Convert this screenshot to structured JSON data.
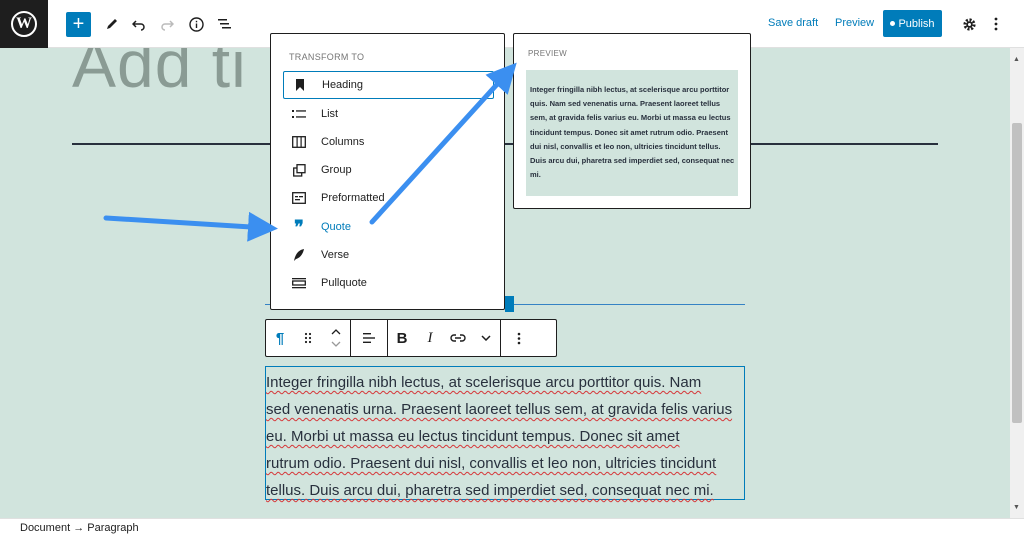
{
  "topbar": {
    "logo_letter": "W",
    "add_label": "+",
    "save_draft": "Save draft",
    "preview": "Preview",
    "publish": "Publish"
  },
  "canvas": {
    "title_text": "Add ti"
  },
  "transform_menu": {
    "header": "TRANSFORM TO",
    "items": [
      {
        "label": "Heading",
        "icon": "bookmark-icon"
      },
      {
        "label": "List",
        "icon": "list-icon"
      },
      {
        "label": "Columns",
        "icon": "columns-icon"
      },
      {
        "label": "Group",
        "icon": "group-icon"
      },
      {
        "label": "Preformatted",
        "icon": "preformatted-icon"
      },
      {
        "label": "Quote",
        "icon": "quote-icon"
      },
      {
        "label": "Verse",
        "icon": "feather-icon"
      },
      {
        "label": "Pullquote",
        "icon": "pullquote-icon"
      }
    ]
  },
  "preview_panel": {
    "header": "PREVIEW",
    "text": "Integer fringilla nibh lectus, at scelerisque arcu porttitor quis. Nam sed venenatis urna. Praesent laoreet tellus sem, at gravida felis varius eu. Morbi ut massa eu lectus tincidunt tempus. Donec sit amet rutrum odio. Praesent dui nisl, convallis et leo non, ultricies tincidunt tellus. Duis arcu dui, pharetra sed imperdiet sed, consequat nec mi."
  },
  "paragraph": {
    "lines": [
      "Integer fringilla nibh lectus, at scelerisque arcu porttitor quis. Nam",
      "sed venenatis urna. Praesent laoreet tellus sem, at gravida felis varius",
      "eu. Morbi ut massa eu lectus tincidunt tempus. Donec sit amet",
      "rutrum odio. Praesent dui nisl, convallis et leo non, ultricies tincidunt",
      "tellus. Duis arcu dui, pharetra sed imperdiet sed, consequat nec mi."
    ]
  },
  "statusbar": {
    "breadcrumb": "Document → Paragraph"
  },
  "colors": {
    "accent": "#007cba",
    "canvas_bg": "#d1e4dd",
    "arrow": "#3b8ff0"
  }
}
